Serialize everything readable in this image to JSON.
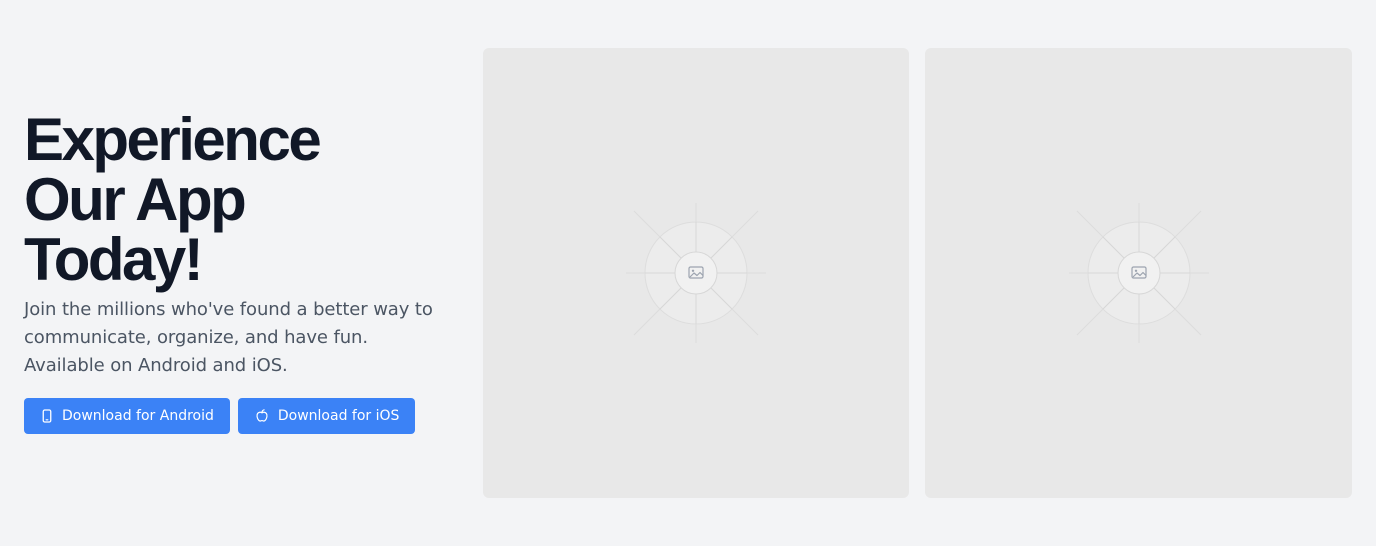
{
  "hero": {
    "headline": "Experience Our App Today!",
    "subtext": "Join the millions who've found a better way to communicate, organize, and have fun. Available on Android and iOS.",
    "buttons": {
      "android_label": "Download for Android",
      "ios_label": "Download for iOS"
    }
  },
  "colors": {
    "background": "#f3f4f6",
    "headline": "#111827",
    "subtext": "#4b5563",
    "button": "#3b82f6",
    "image_placeholder": "#e8e8e8"
  },
  "icons": {
    "android_button": "smartphone-icon",
    "ios_button": "apple-icon",
    "media_placeholder": "image-placeholder-icon"
  }
}
